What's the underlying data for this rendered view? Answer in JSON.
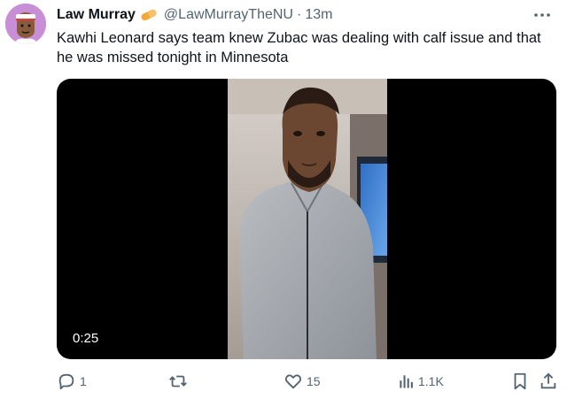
{
  "author": {
    "display_name": "Law Murray",
    "handle": "@LawMurrayTheNU",
    "separator": "·",
    "time_ago": "13m",
    "badge_icon": "pill-badge-icon"
  },
  "tweet": {
    "text": "Kawhi Leonard says team knew Zubac was dealing with calf issue and that he was missed tonight in Minnesota"
  },
  "media": {
    "type": "video",
    "duration": "0:25"
  },
  "actions": {
    "reply_count": "1",
    "retweet_count": "",
    "like_count": "15",
    "view_count": "1.1K"
  },
  "colors": {
    "text": "#0f1419",
    "secondary": "#536471",
    "avatar_bg": "#c98fd6",
    "badge": "#f2a93b"
  }
}
